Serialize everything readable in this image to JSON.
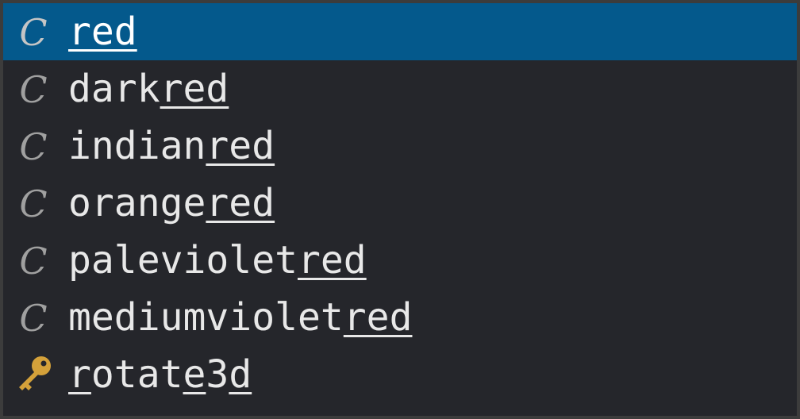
{
  "suggest": {
    "items": [
      {
        "kind": "color-value-icon",
        "kind_glyph": "C",
        "segments": [
          {
            "text": "red",
            "match": true
          }
        ],
        "selected": true
      },
      {
        "kind": "color-value-icon",
        "kind_glyph": "C",
        "segments": [
          {
            "text": "dark",
            "match": false
          },
          {
            "text": "red",
            "match": true
          }
        ],
        "selected": false
      },
      {
        "kind": "color-value-icon",
        "kind_glyph": "C",
        "segments": [
          {
            "text": "indian",
            "match": false
          },
          {
            "text": "red",
            "match": true
          }
        ],
        "selected": false
      },
      {
        "kind": "color-value-icon",
        "kind_glyph": "C",
        "segments": [
          {
            "text": "orange",
            "match": false
          },
          {
            "text": "red",
            "match": true
          }
        ],
        "selected": false
      },
      {
        "kind": "color-value-icon",
        "kind_glyph": "C",
        "segments": [
          {
            "text": "paleviolet",
            "match": false
          },
          {
            "text": "red",
            "match": true
          }
        ],
        "selected": false
      },
      {
        "kind": "color-value-icon",
        "kind_glyph": "C",
        "segments": [
          {
            "text": "mediumviolet",
            "match": false
          },
          {
            "text": "red",
            "match": true
          }
        ],
        "selected": false
      },
      {
        "kind": "key-icon",
        "kind_glyph": "",
        "segments": [
          {
            "text": "r",
            "match": true
          },
          {
            "text": "otat",
            "match": false
          },
          {
            "text": "e",
            "match": true
          },
          {
            "text": "3",
            "match": false
          },
          {
            "text": "d",
            "match": true
          }
        ],
        "selected": false
      }
    ]
  },
  "colors": {
    "background": "#25262b",
    "selected_background": "#04598c",
    "text": "#e8e8e8",
    "icon": "#a0a0a0",
    "key_gold": "#d4a13a"
  }
}
